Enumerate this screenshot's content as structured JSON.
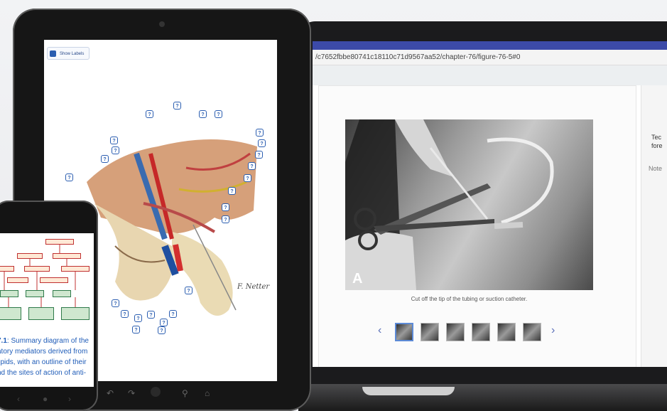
{
  "laptop": {
    "url": "/c7652fbbe80741c18110c71d9567aa52/chapter-76/figure-76-5#0",
    "figure_letter": "A",
    "caption": "Cut off the tip of the tubing or suction catheter.",
    "prev_icon": "chevron-left-icon",
    "next_icon": "chevron-right-icon",
    "thumb_count": 6,
    "selected_thumb": 0,
    "right_panel": {
      "line1": "Tec",
      "line2": "fore",
      "line3": "Note"
    },
    "accent_color": "#3c4aa8"
  },
  "tablet": {
    "show_labels": "Show Labels",
    "signature": "F. Netter",
    "q_mark": "?",
    "bottom_icons": [
      "back-icon",
      "forward-icon",
      "home-button",
      "search-icon",
      "home-icon"
    ]
  },
  "phone": {
    "text_bold": "7.1",
    "text_lines": [
      ": Summary diagram of the",
      "atory mediators derived from",
      "lipids, with an outline of their",
      "nd the sites of action of anti-"
    ]
  }
}
